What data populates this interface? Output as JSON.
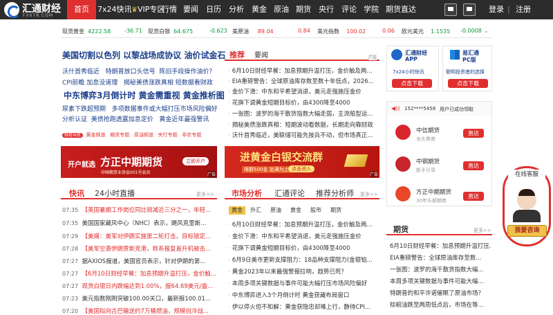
{
  "logo": {
    "name": "汇通财经",
    "url": "FX678.COM"
  },
  "nav": {
    "home": "首页",
    "items": [
      "7x24快讯",
      "VIP专区",
      "行情",
      "要闻",
      "日历",
      "分析",
      "黄金",
      "原油",
      "期货",
      "央行",
      "评论",
      "学院",
      "期货直达"
    ],
    "login": "登录",
    "sep": "|",
    "register": "注册"
  },
  "ticker": [
    {
      "name": "现货黄金",
      "price": "4222.58",
      "change": "-36.71",
      "dir": "down"
    },
    {
      "name": "现货白银",
      "price": "64.675",
      "change": "-0.623",
      "dir": "down"
    },
    {
      "name": "美原油",
      "price": "89.04",
      "change": "0.84",
      "dir": "up"
    },
    {
      "name": "美元指数",
      "price": "100.02",
      "change": "0.06",
      "dir": "up"
    },
    {
      "name": "欧元美元",
      "price": "1.1535",
      "change": "-0.0008",
      "dir": "down"
    }
  ],
  "headlines": {
    "main": "美国切割以色列 以黎战场成协议 油价试金石",
    "row1": [
      "沃什首秀临近",
      "特朗普放口头信号",
      "陈旧手段操作油价？"
    ],
    "row2": [
      "CPI前瞻",
      "加息没道理",
      "揭秘美债涨跌真相",
      "短数据看财政"
    ],
    "second": "中东博弈3月倒计时 黄金需重视 黄金推析图",
    "row3": [
      "尿素下跌超预期",
      "多项数据事件或大幅打压市场风险偏好"
    ],
    "row4": [
      "分析认证",
      "美债抢跑透露加息定价",
      "黄金近年最强警讯"
    ],
    "tags": [
      "黄金频道",
      "期货专题",
      "原油频道",
      "央行专题",
      "非农专题"
    ],
    "badge": "财经导航"
  },
  "ad1": {
    "left": "开户就选",
    "brand": "方正中期期货",
    "btn": "立即开户",
    "sub": "中国期货业协会001号会员",
    "tag": "广告"
  },
  "ad2": {
    "title": "进黄金白银交流群",
    "sub": "限群500名 加满为止",
    "btn": "点击进入",
    "tag": "广告"
  },
  "recommend": {
    "tabs": [
      "推荐",
      "要闻"
    ],
    "badge": "广告",
    "items": [
      "6月10日财经早餐：加息预期升温打压，金价触及两...",
      "EIA重磅警告：全球原油库存数至数十年低点，2026...",
      "金价下滑：中东和平希望消退，美元走强施压金价",
      "花旗下调黄金短期目标价，由4300降至4000",
      "一张图：波罗的海干散货指数大幅走弱，主流船型运...",
      "揭秘美债涨跌真相：短期波动看数据，长期走向靠财政",
      "沃什首秀临近，美联储可能先按兵不动，但市场真正..."
    ]
  },
  "flash": {
    "tabs": [
      "快讯",
      "24小时直播"
    ],
    "more": "更多>>",
    "items": [
      {
        "time": "07:35",
        "text": "【英国暑期工作岗位同比锐减近三分之一，年轻..."
      },
      {
        "time": "07:35",
        "text": "美国国家藏风中心（NHC）表示，飓风克里斯..."
      },
      {
        "time": "07:29",
        "text": "【美媒：美军对伊朗实施第二轮打击，目标锁定..."
      },
      {
        "time": "07:28",
        "text": "【美军空袭伊朗贾斯克港，称系报复直升机被击..."
      },
      {
        "time": "07:27",
        "text": "据AXIOS报道，美国官员表示，针对伊朗的第..."
      },
      {
        "time": "07:27",
        "text": "【6月10日财经早餐：加息预期升温打压，金价触..."
      },
      {
        "time": "07:27",
        "text": "现货白银日内跌幅达到1.00%，报64.69美元/盎..."
      },
      {
        "time": "07:23",
        "text": "美元指数刚刚突破100.00关口，最新报100.01..."
      },
      {
        "time": "07:20",
        "text": "【美国拟向古巴输送约7万桶燃油，规模创冷战..."
      }
    ]
  },
  "analysis": {
    "tabs": [
      "市场分析",
      "汇通评论",
      "推荐分析师"
    ],
    "more": "更多>>",
    "subtabs": [
      "黄金",
      "外汇",
      "原油",
      "黄金",
      "股市",
      "期货"
    ],
    "items": [
      "6月10日财经早餐：加息预期升温打压，金价触及两...",
      "金价下滑：中东和平希望消退，美元走强施压金价",
      "花旗下调黄金短期目标价，由4300降至4000",
      "6月9日美市更新支撑阻力：18品种支撑阻力(金银铂...",
      "黄金2023年以来最强警报拉响，趋势已死？",
      "本周多项关键数据与事件可能大幅打压市场风险偏好",
      "中东博弈进入3个月倒计时 黄金获藏布局窗口",
      "伊以停火但不和解：黄金获隐忠却难上行，静待CPI..."
    ]
  },
  "apps": {
    "app1": {
      "name": "汇通财经",
      "name2": "APP",
      "desc": "7x24小时快讯",
      "btn": "点击下载"
    },
    "app2": {
      "name": "易汇通",
      "name2": "PC版",
      "desc": "聪明投资者的选择",
      "btn": "点击下载"
    }
  },
  "accounts": {
    "user": "152****5458",
    "note": "用户已成功领取",
    "items": [
      {
        "name": "中信期货",
        "sub": "龙头券商",
        "btn": "直达",
        "color": "#d9262c"
      },
      {
        "name": "中钢期货",
        "sub": "新手引导",
        "btn": "直达",
        "color": "#c8252c"
      },
      {
        "name": "方正中期期货",
        "sub": "30年头部期商",
        "btn": "直达",
        "color": "#e8472a"
      }
    ]
  },
  "futures": {
    "title": "期货",
    "more": "更多>>",
    "items": [
      "6月10日财经早餐：加息预期升温打压...",
      "EIA重磅警告：全球原油库存至数...",
      "一张图：波罗的海干散货指数大幅...",
      "本周多项关键数据与事件可能大幅...",
      "特朗普的和平许诺催眠了原油市场？",
      "棕榈油跌至两周低点后，市场在等..."
    ]
  },
  "service": {
    "title": "在线客服",
    "btn": "我要咨询"
  }
}
